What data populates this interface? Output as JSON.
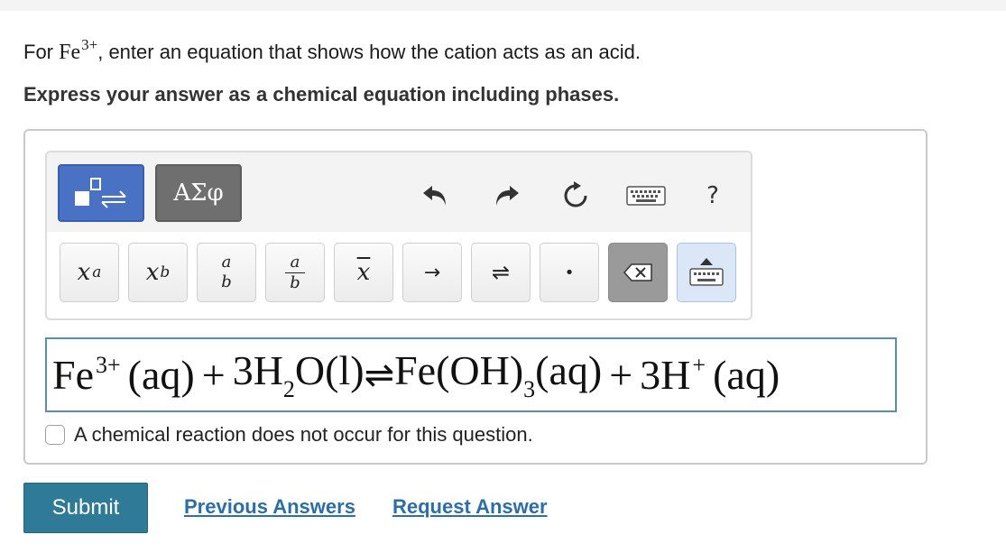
{
  "question": {
    "prefix": "For",
    "ion_symbol": "Fe",
    "ion_charge": "3+",
    "suffix": ", enter an equation that shows how the cation acts as an acid."
  },
  "instruction": "Express your answer as a chemical equation including phases.",
  "toolbar": {
    "mode_templates_icon": "templates-equilibrium-icon",
    "mode_greek_label": "ΑΣφ",
    "undo_icon": "undo-icon",
    "redo_icon": "redo-icon",
    "reset_icon": "reset-icon",
    "keyboard_icon": "keyboard-icon",
    "help_label": "?",
    "keys": {
      "superscript_base": "x",
      "superscript_exp": "a",
      "subscript_base": "x",
      "subscript_sub": "b",
      "fraction_num": "a",
      "fraction_den": "b",
      "bar_fraction_num": "a",
      "bar_fraction_den": "b",
      "overline_label": "x",
      "arrow_label": "→",
      "equilibrium_label": "⇌",
      "dot_label": "•",
      "delete_icon": "backspace-icon",
      "keyboard_toggle_icon": "keyboard-toggle-icon"
    }
  },
  "equation": {
    "r1_base": "Fe",
    "r1_charge": "3+",
    "r1_phase": "(aq)",
    "plus1": "+",
    "r2_coef_base": "3H",
    "r2_sub": "2",
    "r2_rest": "O(l)",
    "arrow": "⇌",
    "p1_base": "Fe(OH)",
    "p1_sub": "3",
    "p1_phase": "(aq)",
    "plus2": "+",
    "p2_base": "3H",
    "p2_charge": "+",
    "p2_phase": "(aq)"
  },
  "no_reaction_label": "A chemical reaction does not occur for this question.",
  "actions": {
    "submit": "Submit",
    "previous_answers": "Previous Answers",
    "request_answer": "Request Answer"
  },
  "colors": {
    "accent_blue": "#4a72c4",
    "submit_bg": "#2f7a96",
    "link": "#2d6ea6",
    "field_border": "#5b8ea6"
  }
}
